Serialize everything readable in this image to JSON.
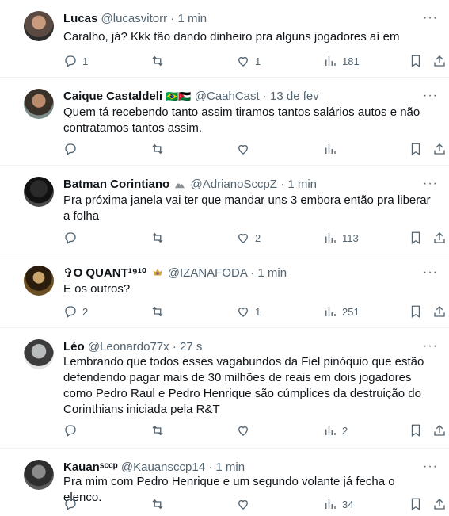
{
  "tweets": [
    {
      "name": "Lucas",
      "handle": "@lucasvitorr",
      "sep": "·",
      "time": "1 min",
      "text": "Caralho, já? Kkk tão dando dinheiro pra alguns jogadores aí em",
      "replies": "1",
      "retweets": "",
      "likes": "1",
      "views": "181"
    },
    {
      "name": "Caique Castaldeli",
      "flags": "🇧🇷🇯🇴",
      "handle": "@CaahCast",
      "sep": "·",
      "time": "13 de fev",
      "text": "Quem tá recebendo tanto assim tiramos tantos salários autos e não contratamos tantos assim.",
      "replies": "",
      "retweets": "",
      "likes": "",
      "views": ""
    },
    {
      "name": "Batman Corintiano",
      "handle": "@AdrianoSccpZ",
      "sep": "·",
      "time": "1 min",
      "text": "Pra próxima janela vai ter que mandar uns 3 embora então pra liberar a folha",
      "replies": "",
      "retweets": "",
      "likes": "2",
      "views": "113"
    },
    {
      "name": "✞O QUANT¹⁹¹⁰",
      "handle": "@IZANAFODA",
      "sep": "·",
      "time": "1 min",
      "text": "E os outros?",
      "replies": "2",
      "retweets": "",
      "likes": "1",
      "views": "251"
    },
    {
      "name": "Léo",
      "handle": "@Leonardo77x",
      "sep": "·",
      "time": "27 s",
      "text": "Lembrando que todos esses vagabundos da Fiel pinóquio que estão defendendo pagar mais de 30 milhões de reais em dois jogadores como Pedro Raul e Pedro Henrique são cúmplices da destruição do Corinthians iniciada pela R&T",
      "replies": "",
      "retweets": "",
      "likes": "",
      "views": "2"
    },
    {
      "name": "Kauanˢᶜᶜᵖ",
      "handle": "@Kauansccp14",
      "sep": "·",
      "time": "1 min",
      "text": "Pra mim com Pedro Henrique e um segundo volante já fecha o elenco.",
      "replies": "",
      "retweets": "",
      "likes": "",
      "views": "34"
    }
  ],
  "icons": {
    "more": "more-dots-icon",
    "reply": "reply-icon",
    "retweet": "retweet-icon",
    "like": "heart-icon",
    "views": "views-chart-icon",
    "bookmark": "bookmark-icon",
    "share": "share-icon"
  },
  "colors": {
    "muted": "#536471",
    "text": "#0f1419",
    "border": "#eff3f4"
  }
}
